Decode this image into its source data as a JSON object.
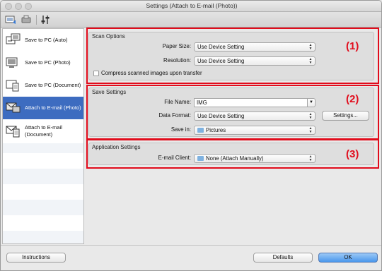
{
  "window": {
    "title": "Settings (Attach to E-mail (Photo))"
  },
  "sidebar": {
    "items": [
      {
        "label": "Save to PC (Auto)",
        "icon": "save-to-pc-auto-icon",
        "selected": false
      },
      {
        "label": "Save to PC (Photo)",
        "icon": "save-to-pc-photo-icon",
        "selected": false
      },
      {
        "label": "Save to PC (Document)",
        "icon": "save-to-pc-document-icon",
        "selected": false
      },
      {
        "label": "Attach to E-mail (Photo)",
        "icon": "attach-email-photo-icon",
        "selected": true
      },
      {
        "label": "Attach to E-mail (Document)",
        "line1": "Attach to E-mail",
        "line2": "(Document)",
        "icon": "attach-email-document-icon",
        "selected": false
      }
    ]
  },
  "scan_options": {
    "title": "Scan Options",
    "paper_size_label": "Paper Size:",
    "paper_size_value": "Use Device Setting",
    "resolution_label": "Resolution:",
    "resolution_value": "Use Device Setting",
    "compress_label": "Compress scanned images upon transfer",
    "compress_checked": false
  },
  "save_settings": {
    "title": "Save Settings",
    "file_name_label": "File Name:",
    "file_name_value": "IMG",
    "data_format_label": "Data Format:",
    "data_format_value": "Use Device Setting",
    "settings_button": "Settings...",
    "save_in_label": "Save in:",
    "save_in_value": "Pictures"
  },
  "app_settings": {
    "title": "Application Settings",
    "email_client_label": "E-mail Client:",
    "email_client_value": "None (Attach Manually)"
  },
  "callouts": {
    "one": "(1)",
    "two": "(2)",
    "three": "(3)"
  },
  "footer": {
    "instructions": "Instructions",
    "defaults": "Defaults",
    "ok": "OK"
  },
  "colors": {
    "highlight_red": "#e10b1b",
    "selection_blue": "#3d6cc0",
    "ok_blue": "#4a97ec"
  }
}
